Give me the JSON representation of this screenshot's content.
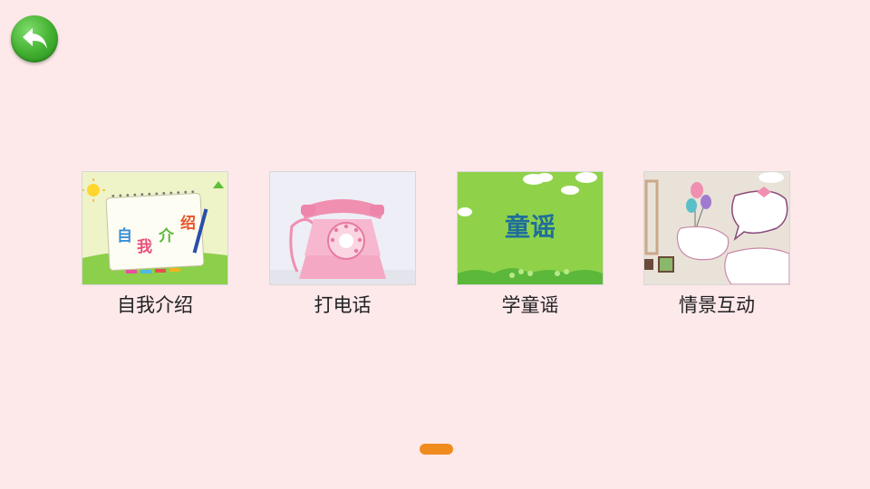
{
  "header": {
    "back_icon": "back-arrow-icon",
    "back_color": "#3fae2e"
  },
  "cards": [
    {
      "label": "自我介绍",
      "thumb_text": [
        "自",
        "我",
        "介",
        "绍"
      ],
      "icon": "notebook-image"
    },
    {
      "label": "打电话",
      "icon": "telephone-image"
    },
    {
      "label": "学童谣",
      "thumb_text": "童谣",
      "icon": "nursery-rhyme-image"
    },
    {
      "label": "情景互动",
      "icon": "balloons-image"
    }
  ],
  "pager": {
    "active_color": "#f08c1e"
  }
}
